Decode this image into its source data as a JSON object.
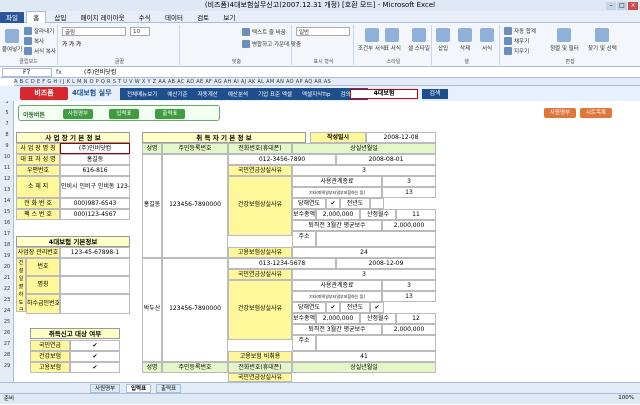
{
  "window": {
    "title": "(비즈폼)4대보험실무신고(2007.12.31 개정) [호환 모드] - Microsoft Excel"
  },
  "ribbon_tabs": [
    "파일",
    "홈",
    "삽입",
    "페이지 레이아웃",
    "수식",
    "데이터",
    "검토",
    "보기"
  ],
  "ribbon": {
    "clipboard": {
      "paste": "붙여넣기",
      "cut": "잘라내기",
      "copy": "복사",
      "painter": "서식 복사",
      "label": "클립보드"
    },
    "font": {
      "name": "굴림",
      "size": "10",
      "label": "글꼴"
    },
    "align": {
      "wrap": "텍스트 줄 바꿈",
      "merge": "병합하고 가운데 맞춤",
      "label": "맞춤"
    },
    "number": {
      "format": "일반",
      "label": "표시 형식"
    },
    "styles": {
      "cond": "조건부 서식",
      "table": "표 서식",
      "cell": "셀 스타일",
      "label": "스타일"
    },
    "cells": {
      "insert": "삽입",
      "delete": "삭제",
      "format": "서식",
      "label": "셀"
    },
    "edit": {
      "autosum": "자동 합계",
      "fill": "채우기",
      "clear": "지우기",
      "sort": "정렬 및 필터",
      "find": "찾기 및 선택",
      "label": "편집"
    }
  },
  "formula_bar": {
    "cell": "F7",
    "fx": "fx",
    "value": "(주)인비닷컴"
  },
  "columns": "A B C D E F G H I J K L M N O P Q R S T U V W X Y Z AA AB AC AD AE AF AG AH AI AJ AK AL AM AN AO AP AQ AR AS",
  "rows": [
    "1",
    "3",
    "5",
    "7",
    "8",
    "9",
    "10",
    "11",
    "12",
    "13",
    "14",
    "15",
    "16",
    "17",
    "18",
    "19",
    "20",
    "21",
    "22",
    "23",
    "24",
    "25",
    "26",
    "27",
    "28",
    "29"
  ],
  "nav": {
    "logo": "비즈폼",
    "logo2": "4대보험 실무",
    "menu": [
      "전체메뉴보기",
      "예산기준",
      "자동계산",
      "예산분석",
      "기업 표준 엑셀",
      "엑셀지식Tip",
      "검의실무"
    ],
    "insurance_field": "4대보험",
    "insurance_btn": "검색"
  },
  "subnav": {
    "title": "이동버튼",
    "buttons": [
      "사원명부",
      "입력표",
      "출력표"
    ]
  },
  "actions": {
    "save": "사원명부",
    "sheet": "시트목록"
  },
  "company": {
    "title": "사 업 장 기 본 정 보",
    "rows": [
      {
        "label": "사 업 장 명 칭",
        "value": "(주)인비닷컴"
      },
      {
        "label": "대 표 자 성 명",
        "value": "홍길동"
      },
      {
        "label": "우편번호",
        "value": "616-816"
      },
      {
        "label": "소  재  지",
        "value": "인비시 인비구 인비동 123-45"
      },
      {
        "label": "전 화 번 호",
        "value": "000)987-6543"
      },
      {
        "label": "팩 스 번 호",
        "value": "000)123-4567"
      }
    ]
  },
  "insurance": {
    "title": "4대보험 기본정보",
    "rows": [
      {
        "label": "사업장 관리번호",
        "value": "123-45-67898-1"
      },
      {
        "label": "번호",
        "value": ""
      },
      {
        "label": "명칭",
        "value": ""
      },
      {
        "label": "하수급인번호",
        "value": ""
      }
    ],
    "side": "건설 일괄 하도급 사업장"
  },
  "report": {
    "title": "취득신고 대상 여부",
    "rows": [
      {
        "label": "국민연금",
        "checked": "✔"
      },
      {
        "label": "건강보험",
        "checked": "✔"
      },
      {
        "label": "고용보험",
        "checked": "✔"
      }
    ]
  },
  "acq": {
    "title": "취 득 자  기 본 정 보",
    "date_label": "작성일시",
    "date": "2008-12-08",
    "headers": [
      "성명",
      "주민등록번호",
      "전화번호(휴대폰)",
      "상실년월일"
    ],
    "persons": [
      {
        "name": "홍길동",
        "rrn": "123456-7890000",
        "phone": "012-3456-7890",
        "date": "2008-08-01",
        "rows": [
          {
            "label": "국민연금상실사유",
            "value": "3"
          },
          {
            "label": "사용관계종료",
            "value": "3"
          },
          {
            "label": "기타(퇴직일부터일부포함하는 등)",
            "value": "13"
          },
          {
            "label": "당해연도",
            "value": "✔"
          },
          {
            "label": "전년도",
            "value": ""
          },
          {
            "label": "보수총액",
            "value": "2,000,000"
          },
          {
            "label": "산정월수",
            "value": "11"
          },
          {
            "label": "퇴직전 3월간 평균보수",
            "value": "2,000,000"
          },
          {
            "label": "주소",
            "value": ""
          },
          {
            "label": "고용보험상실사유",
            "value": "24"
          }
        ],
        "health_label": "건강보험상실사유"
      },
      {
        "name": "박두산",
        "rrn": "123456-7890000",
        "phone": "013-1234-5678",
        "date": "2008-12-09",
        "rows": [
          {
            "label": "국민연금상실사유",
            "value": "3"
          },
          {
            "label": "사용관계종료",
            "value": "3"
          },
          {
            "label": "기타(퇴직일부터일부포함하는 등)",
            "value": "13"
          },
          {
            "label": "당해연도",
            "value": "✔"
          },
          {
            "label": "전년도",
            "value": "✔"
          },
          {
            "label": "보수총액",
            "value": "2,000,000"
          },
          {
            "label": "산정월수",
            "value": "12"
          },
          {
            "label": "퇴직전 3월간 평균보수",
            "value": "2,000,000"
          },
          {
            "label": "주소",
            "value": ""
          },
          {
            "label": "고용보험 비취용",
            "value": "41"
          }
        ],
        "health_label": "건강보험상실사유"
      }
    ],
    "footer_headers": [
      "성명",
      "주민등록번호",
      "전화번호(휴대폰)",
      "상실년월일"
    ],
    "footer_row": "국민연금상실사유"
  },
  "sheet_tabs": [
    "사원명부",
    "입력표",
    "출력표"
  ],
  "status": "준비",
  "zoom": "100%"
}
